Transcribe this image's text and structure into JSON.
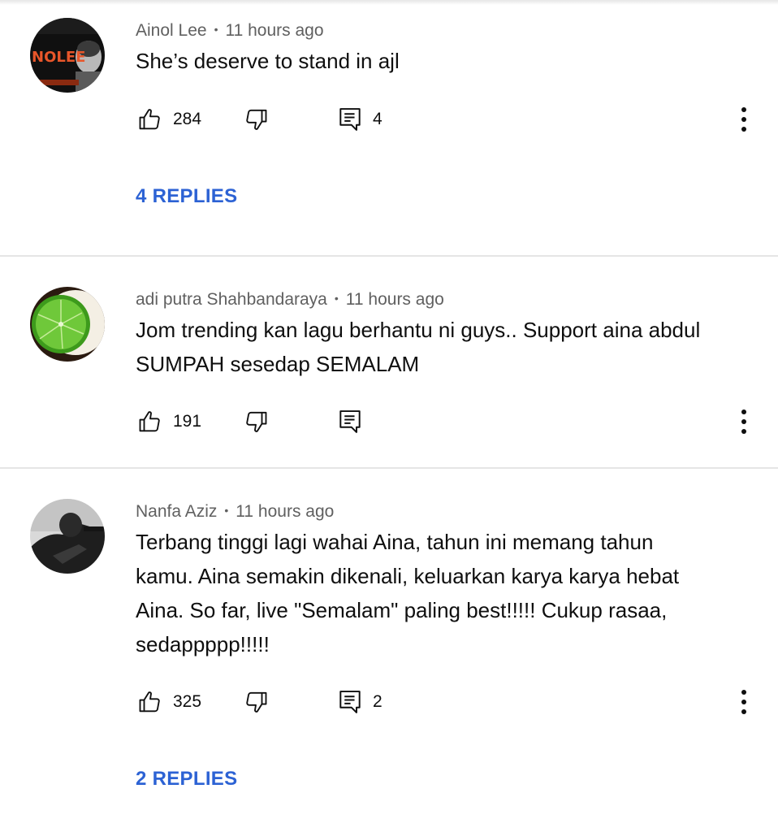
{
  "comments": [
    {
      "author": "Ainol Lee",
      "time": "11 hours ago",
      "text": "She’s deserve to stand in ajl",
      "likes": "284",
      "reply_count": "4",
      "replies_label": "4 REPLIES",
      "avatar_text": "NOLEE"
    },
    {
      "author": "adi putra Shahbandaraya",
      "time": "11 hours ago",
      "text": "Jom trending kan lagu berhantu ni guys.. Support aina abdul SUMPAH sesedap SEMALAM",
      "likes": "191",
      "reply_count": "",
      "replies_label": ""
    },
    {
      "author": "Nanfa Aziz",
      "time": "11 hours ago",
      "text": "Terbang tinggi lagi wahai Aina, tahun ini memang tahun kamu. Aina semakin dikenali, keluarkan karya karya hebat Aina. So far, live \"Semalam\" paling best!!!!! Cukup rasaa, sedappppp!!!!!",
      "likes": "325",
      "reply_count": "2",
      "replies_label": "2 REPLIES"
    }
  ],
  "icons": {
    "like": "thumb-up-icon",
    "dislike": "thumb-down-icon",
    "reply": "comment-reply-icon",
    "more": "more-vertical-icon"
  },
  "colors": {
    "link": "#2c62d4",
    "meta": "#606060",
    "text": "#0f0f0f",
    "divider": "#e5e5e5"
  }
}
